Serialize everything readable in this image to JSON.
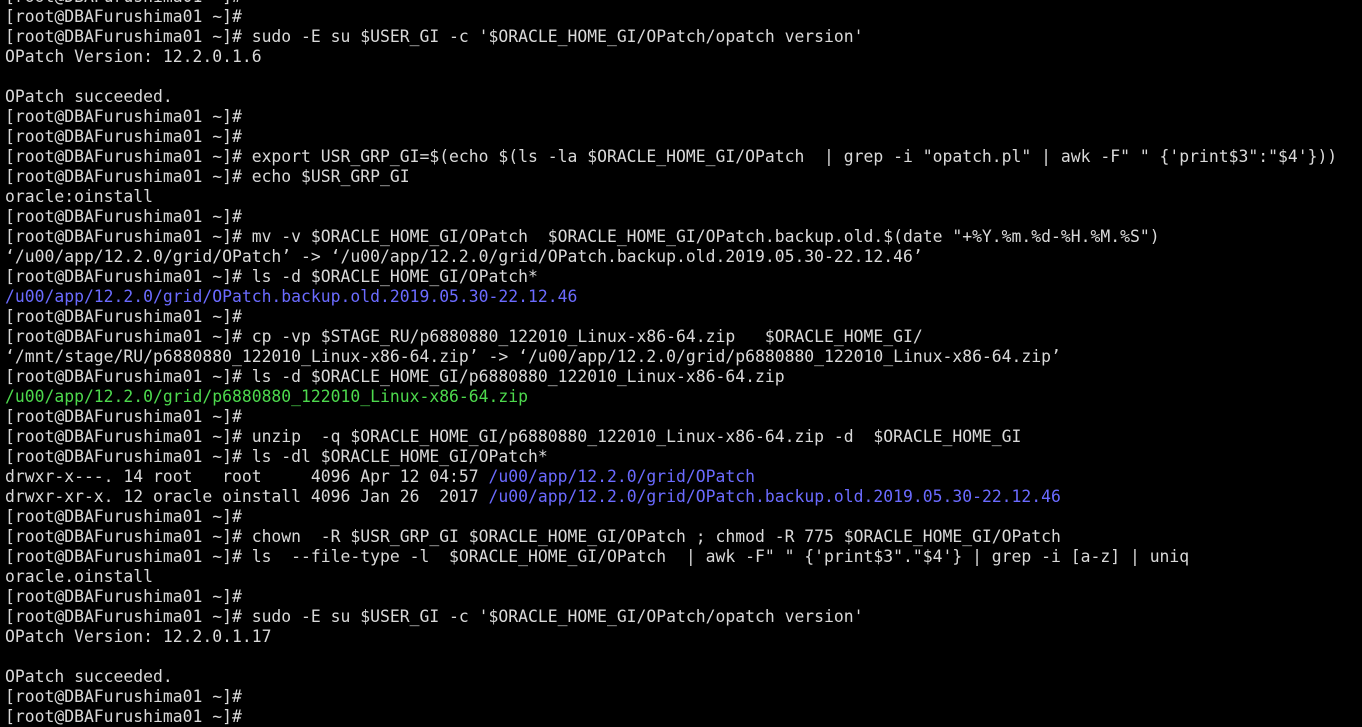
{
  "terminal": {
    "colors": {
      "background": "#000000",
      "text": "#d9d9d9",
      "directory": "#6b6bff",
      "archive": "#4dd94d"
    },
    "lines": [
      {
        "text": "[root@DBAFurushima01 ~]#",
        "kind": "prompt"
      },
      {
        "text": "[root@DBAFurushima01 ~]#",
        "kind": "prompt"
      },
      {
        "text": "[root@DBAFurushima01 ~]# sudo -E su $USER_GI -c '$ORACLE_HOME_GI/OPatch/opatch version'",
        "kind": "command"
      },
      {
        "text": "OPatch Version: 12.2.0.1.6",
        "kind": "output"
      },
      {
        "text": "",
        "kind": "blank"
      },
      {
        "text": "OPatch succeeded.",
        "kind": "output"
      },
      {
        "text": "[root@DBAFurushima01 ~]#",
        "kind": "prompt"
      },
      {
        "text": "[root@DBAFurushima01 ~]#",
        "kind": "prompt"
      },
      {
        "text": "[root@DBAFurushima01 ~]# export USR_GRP_GI=$(echo $(ls -la $ORACLE_HOME_GI/OPatch  | grep -i \"opatch.pl\" | awk -F\" \" {'print$3\":\"$4'}))",
        "kind": "command"
      },
      {
        "text": "[root@DBAFurushima01 ~]# echo $USR_GRP_GI",
        "kind": "command"
      },
      {
        "text": "oracle:oinstall",
        "kind": "output"
      },
      {
        "text": "[root@DBAFurushima01 ~]#",
        "kind": "prompt"
      },
      {
        "text": "[root@DBAFurushima01 ~]# mv -v $ORACLE_HOME_GI/OPatch  $ORACLE_HOME_GI/OPatch.backup.old.$(date \"+%Y.%m.%d-%H.%M.%S\")",
        "kind": "command"
      },
      {
        "text": "‘/u00/app/12.2.0/grid/OPatch’ -> ‘/u00/app/12.2.0/grid/OPatch.backup.old.2019.05.30-22.12.46’",
        "kind": "output"
      },
      {
        "text": "[root@DBAFurushima01 ~]# ls -d $ORACLE_HOME_GI/OPatch*",
        "kind": "command"
      },
      {
        "text": "/u00/app/12.2.0/grid/OPatch.backup.old.2019.05.30-22.12.46",
        "kind": "output",
        "color": "dir"
      },
      {
        "text": "[root@DBAFurushima01 ~]#",
        "kind": "prompt"
      },
      {
        "text": "[root@DBAFurushima01 ~]# cp -vp $STAGE_RU/p6880880_122010_Linux-x86-64.zip   $ORACLE_HOME_GI/",
        "kind": "command"
      },
      {
        "text": "‘/mnt/stage/RU/p6880880_122010_Linux-x86-64.zip’ -> ‘/u00/app/12.2.0/grid/p6880880_122010_Linux-x86-64.zip’",
        "kind": "output"
      },
      {
        "text": "[root@DBAFurushima01 ~]# ls -d $ORACLE_HOME_GI/p6880880_122010_Linux-x86-64.zip",
        "kind": "command"
      },
      {
        "text": "/u00/app/12.2.0/grid/p6880880_122010_Linux-x86-64.zip",
        "kind": "output",
        "color": "zip"
      },
      {
        "text": "[root@DBAFurushima01 ~]#",
        "kind": "prompt"
      },
      {
        "text": "[root@DBAFurushima01 ~]# unzip  -q $ORACLE_HOME_GI/p6880880_122010_Linux-x86-64.zip -d  $ORACLE_HOME_GI",
        "kind": "command"
      },
      {
        "text": "[root@DBAFurushima01 ~]# ls -dl $ORACLE_HOME_GI/OPatch*",
        "kind": "command"
      },
      {
        "text": "drwxr-x---. 14 root   root     4096 Apr 12 04:57 ",
        "kind": "output",
        "suffix": "/u00/app/12.2.0/grid/OPatch",
        "suffix_color": "dir"
      },
      {
        "text": "drwxr-xr-x. 12 oracle oinstall 4096 Jan 26  2017 ",
        "kind": "output",
        "suffix": "/u00/app/12.2.0/grid/OPatch.backup.old.2019.05.30-22.12.46",
        "suffix_color": "dir"
      },
      {
        "text": "[root@DBAFurushima01 ~]#",
        "kind": "prompt"
      },
      {
        "text": "[root@DBAFurushima01 ~]# chown  -R $USR_GRP_GI $ORACLE_HOME_GI/OPatch ; chmod -R 775 $ORACLE_HOME_GI/OPatch",
        "kind": "command"
      },
      {
        "text": "[root@DBAFurushima01 ~]# ls  --file-type -l  $ORACLE_HOME_GI/OPatch  | awk -F\" \" {'print$3\".\"$4'} | grep -i [a-z] | uniq",
        "kind": "command"
      },
      {
        "text": "oracle.oinstall",
        "kind": "output"
      },
      {
        "text": "[root@DBAFurushima01 ~]#",
        "kind": "prompt"
      },
      {
        "text": "[root@DBAFurushima01 ~]# sudo -E su $USER_GI -c '$ORACLE_HOME_GI/OPatch/opatch version'",
        "kind": "command"
      },
      {
        "text": "OPatch Version: 12.2.0.1.17",
        "kind": "output"
      },
      {
        "text": "",
        "kind": "blank"
      },
      {
        "text": "OPatch succeeded.",
        "kind": "output"
      },
      {
        "text": "[root@DBAFurushima01 ~]#",
        "kind": "prompt"
      },
      {
        "text": "[root@DBAFurushima01 ~]#",
        "kind": "prompt"
      }
    ]
  }
}
